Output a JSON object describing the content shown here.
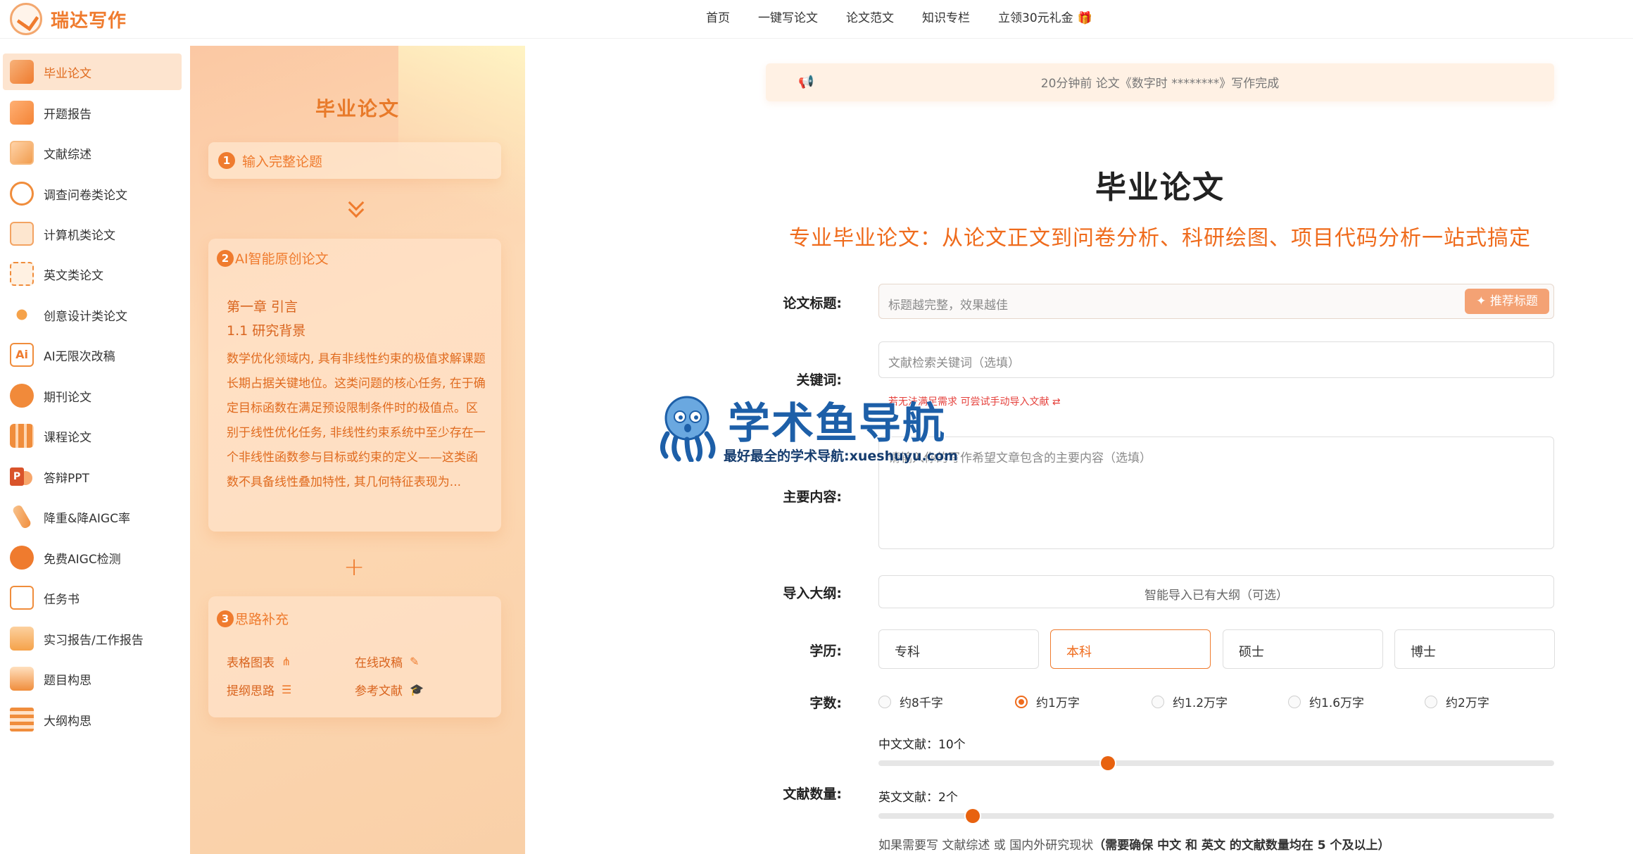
{
  "app": {
    "name": "瑞达写作"
  },
  "topnav": {
    "items": [
      "首页",
      "一键写论文",
      "论文范文",
      "知识专栏",
      "立领30元礼金"
    ]
  },
  "sidebar": {
    "items": [
      {
        "label": "毕业论文",
        "icon": "building-icon",
        "active": true
      },
      {
        "label": "开题报告",
        "icon": "document-icon"
      },
      {
        "label": "文献综述",
        "icon": "notebook-icon"
      },
      {
        "label": "调查问卷类论文",
        "icon": "survey-chart-icon"
      },
      {
        "label": "计算机类论文",
        "icon": "computer-icon"
      },
      {
        "label": "英文类论文",
        "icon": "english-doc-icon"
      },
      {
        "label": "创意设计类论文",
        "icon": "creative-icon"
      },
      {
        "label": "AI无限次改稿",
        "icon": "ai-icon"
      },
      {
        "label": "期刊论文",
        "icon": "journal-icon"
      },
      {
        "label": "课程论文",
        "icon": "books-icon"
      },
      {
        "label": "答辩PPT",
        "icon": "ppt-icon"
      },
      {
        "label": "降重&降AIGC率",
        "icon": "pen-icon"
      },
      {
        "label": "免费AIGC检测",
        "icon": "check-badge-icon"
      },
      {
        "label": "任务书",
        "icon": "clipboard-icon"
      },
      {
        "label": "实习报告/工作报告",
        "icon": "report-icon"
      },
      {
        "label": "题目构思",
        "icon": "lightbulb-icon"
      },
      {
        "label": "大纲构思",
        "icon": "outline-icon"
      }
    ]
  },
  "preview": {
    "title": "毕业论文",
    "step1": {
      "num": "1",
      "label": "输入完整论题"
    },
    "step2": {
      "num": "2",
      "label": "AI智能原创论文",
      "chapter": "第一章 引言",
      "section": "1.1 研究背景",
      "body": "数学优化领域内, 具有非线性约束的极值求解课题长期占据关键地位。这类问题的核心任务, 在于确定目标函数在满足预设限制条件时的极值点。区别于线性优化任务, 非线性约束系统中至少存在一个非线性函数参与目标或约束的定义——这类函数不具备线性叠加特性, 其几何特征表现为..."
    },
    "step3": {
      "num": "3",
      "label": "思路补充",
      "tools": [
        "表格图表",
        "在线改稿",
        "提纲思路",
        "参考文献"
      ]
    }
  },
  "main": {
    "notice": "20分钟前 论文《数字时 ********》写作完成",
    "title": "毕业论文",
    "subtitle": "专业毕业论文：从论文正文到问卷分析、科研绘图、项目代码分析一站式搞定",
    "labels": {
      "title": "论文标题:",
      "keywords": "关键词:",
      "content": "主要内容:",
      "outline": "导入大纲:",
      "degree": "学历:",
      "words": "字数:",
      "refs": "文献数量:"
    },
    "title_placeholder": "标题越完整，效果越佳",
    "recommend_btn": "推荐标题",
    "keywords_placeholder": "文献检索关键词（选填）",
    "keywords_tip": "若无法满足需求 可尝试手动导入文献",
    "content_placeholder": "请输入你的写作希望文章包含的主要内容（选填）",
    "outline_btn": "智能导入已有大纲（可选）",
    "degrees": [
      "专科",
      "本科",
      "硕士",
      "博士"
    ],
    "degree_selected": "本科",
    "word_options": [
      "约8千字",
      "约1万字",
      "约1.2万字",
      "约1.6万字",
      "约2万字"
    ],
    "word_selected": "约1万字",
    "cn_refs": {
      "label": "中文文献：",
      "value": "10个",
      "fraction": 0.34
    },
    "en_refs": {
      "label": "英文文献：",
      "value": "2个",
      "fraction": 0.14
    },
    "footnote_prefix": "如果需要写 文献综述 或 国内外研究现状",
    "footnote_bold": "（需要确保 中文 和 英文 的文献数量均在 5 个及以上）"
  },
  "watermark": {
    "big": "学术鱼导航",
    "small": "最好最全的学术导航:xueshuyu.com"
  },
  "colors": {
    "accent": "#ef7b2e",
    "accent_dark": "#e8620f",
    "watermark_blue": "#1d5fa8"
  }
}
